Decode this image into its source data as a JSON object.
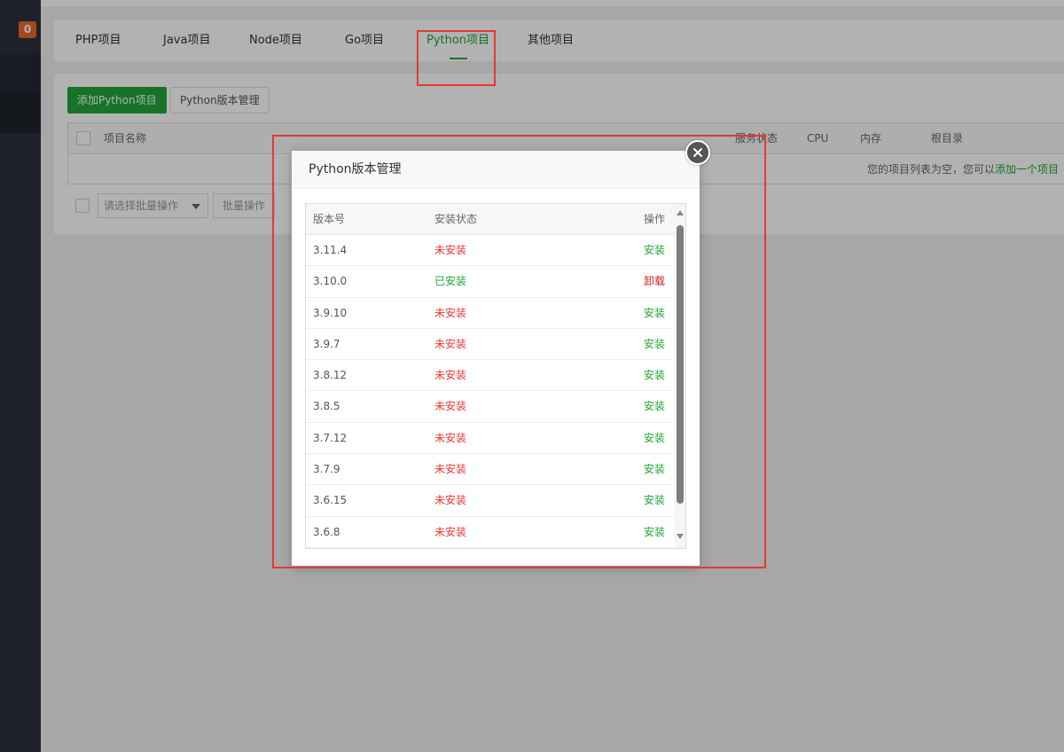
{
  "sidebar": {
    "badge_count": "0"
  },
  "tabs": [
    {
      "label": "PHP项目"
    },
    {
      "label": "Java项目"
    },
    {
      "label": "Node项目"
    },
    {
      "label": "Go项目"
    },
    {
      "label": "Python项目",
      "active": true
    },
    {
      "label": "其他项目"
    }
  ],
  "toolbar": {
    "add_label": "添加Python项目",
    "version_mgmt_label": "Python版本管理"
  },
  "project_table": {
    "headers": {
      "name": "项目名称",
      "status": "服务状态",
      "cpu": "CPU",
      "memory": "内存",
      "root": "根目录"
    },
    "empty_text": "您的项目列表为空，您可以",
    "empty_link": "添加一个项目"
  },
  "batch": {
    "select_placeholder": "请选择批量操作",
    "button_label": "批量操作"
  },
  "modal": {
    "title": "Python版本管理",
    "headers": {
      "version": "版本号",
      "status": "安装状态",
      "action": "操作"
    },
    "rows": [
      {
        "version": "3.11.4",
        "status": "未安装",
        "action": "安装"
      },
      {
        "version": "3.10.0",
        "status": "已安装",
        "action": "卸载"
      },
      {
        "version": "3.9.10",
        "status": "未安装",
        "action": "安装"
      },
      {
        "version": "3.9.7",
        "status": "未安装",
        "action": "安装"
      },
      {
        "version": "3.8.12",
        "status": "未安装",
        "action": "安装"
      },
      {
        "version": "3.8.5",
        "status": "未安装",
        "action": "安装"
      },
      {
        "version": "3.7.12",
        "status": "未安装",
        "action": "安装"
      },
      {
        "version": "3.7.9",
        "status": "未安装",
        "action": "安装"
      },
      {
        "version": "3.6.15",
        "status": "未安装",
        "action": "安装"
      },
      {
        "version": "3.6.8",
        "status": "未安装",
        "action": "安装"
      }
    ]
  },
  "colors": {
    "accent_green": "#20a53a",
    "not_installed": "#e53935",
    "uninstall": "#cc2020",
    "highlight_box": "#e53935",
    "badge": "#e8672f"
  }
}
